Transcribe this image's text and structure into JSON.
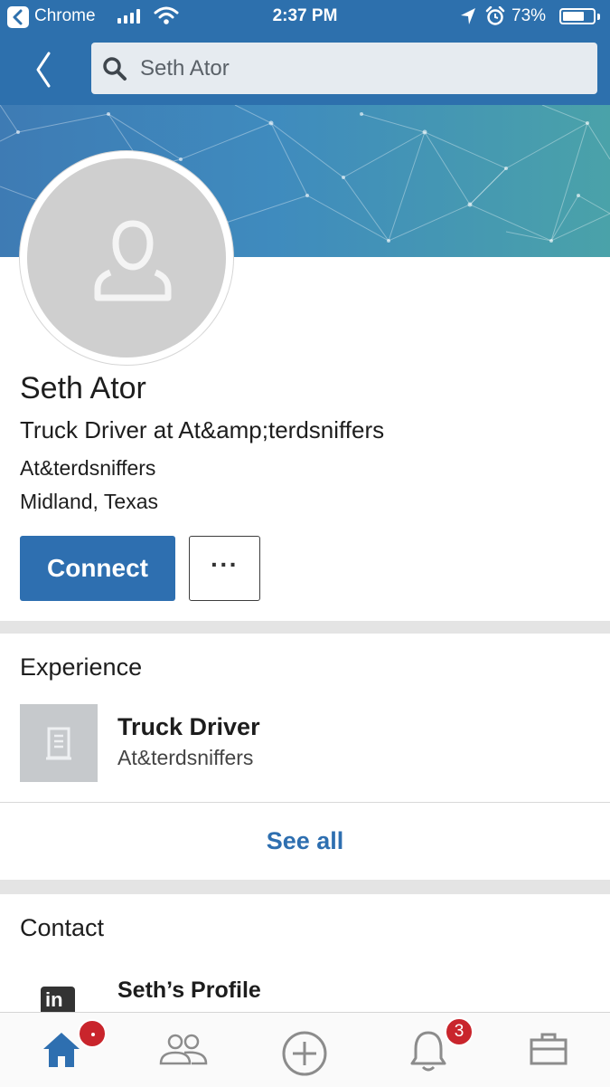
{
  "status_bar": {
    "app_name": "Chrome",
    "time": "2:37 PM",
    "battery_percent": "73%",
    "battery_level": 0.73,
    "icons": [
      "back-to-app-icon",
      "signal-icon",
      "wifi-icon",
      "location-arrow-icon",
      "alarm-icon",
      "battery-icon"
    ]
  },
  "nav": {
    "back_icon": "chevron-left-icon",
    "search_icon": "search-icon",
    "search_value": "Seth Ator"
  },
  "profile": {
    "name": "Seth Ator",
    "headline": "Truck Driver at At&amp;terdsniffers",
    "company": "At&terdsniffers",
    "location": "Midland, Texas",
    "connect_label": "Connect",
    "more_label": "···",
    "avatar_icon": "person-placeholder-icon"
  },
  "experience": {
    "title": "Experience",
    "items": [
      {
        "role": "Truck Driver",
        "company": "At&terdsniffers",
        "logo_icon": "building-icon"
      }
    ],
    "see_all_label": "See all"
  },
  "contact": {
    "title": "Contact",
    "items": [
      {
        "label": "Seth’s Profile",
        "icon": "linkedin-icon"
      }
    ]
  },
  "tabbar": {
    "tabs": [
      {
        "name": "home",
        "icon": "home-icon",
        "active": true
      },
      {
        "name": "network",
        "icon": "people-icon",
        "active": false
      },
      {
        "name": "post",
        "icon": "plus-circle-icon",
        "active": false
      },
      {
        "name": "notifications",
        "icon": "bell-icon",
        "active": false
      },
      {
        "name": "jobs",
        "icon": "briefcase-icon",
        "active": false
      }
    ],
    "home_badge": "·",
    "notifications_badge": "3"
  },
  "colors": {
    "brand_blue": "#2d70ad",
    "button_blue": "#2e6fb0",
    "badge_red": "#c9252c",
    "cover_start": "#3e7bb4",
    "cover_end": "#4aa2a9"
  }
}
